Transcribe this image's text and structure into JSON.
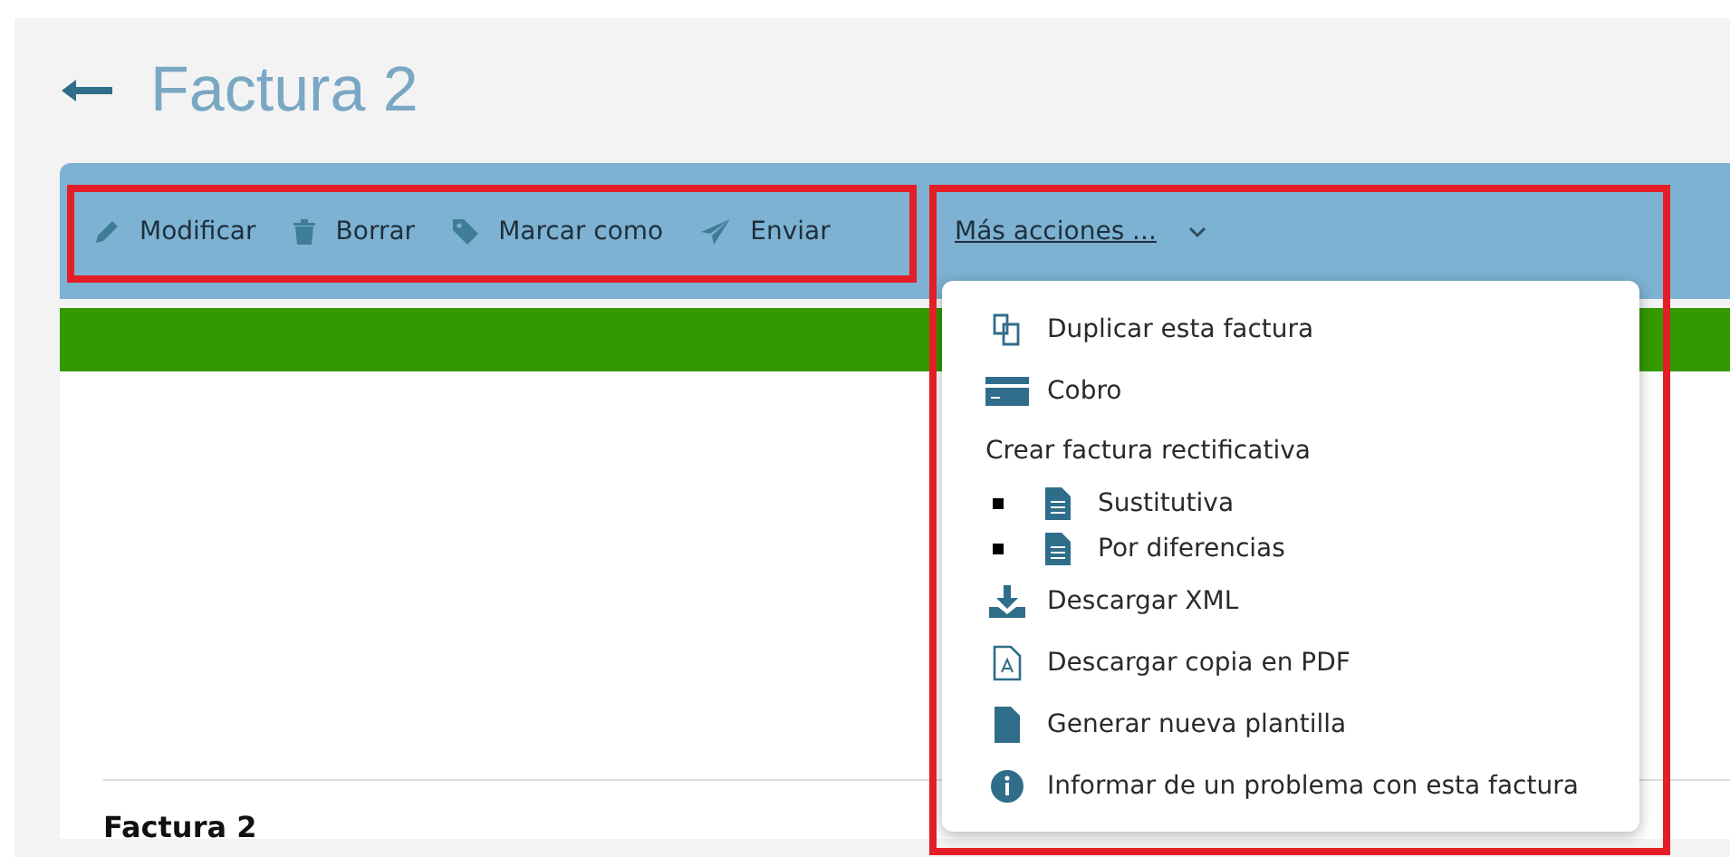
{
  "header": {
    "title": "Factura 2"
  },
  "toolbar": {
    "highlighted": true,
    "actions": [
      {
        "label": "Modificar",
        "kind": "pencil"
      },
      {
        "label": "Borrar",
        "kind": "trash"
      },
      {
        "label": "Marcar como",
        "kind": "tag"
      },
      {
        "label": "Enviar",
        "kind": "send"
      }
    ],
    "more_actions": {
      "label": "Más acciones ...",
      "expanded": true,
      "highlighted": true
    }
  },
  "menu": [
    {
      "kind": "duplicate",
      "label": "Duplicar esta factura"
    },
    {
      "kind": "card",
      "label": "Cobro"
    },
    {
      "kind": "heading",
      "label": "Crear factura rectificativa"
    },
    {
      "kind": "document",
      "label": "Sustitutiva"
    },
    {
      "kind": "document",
      "label": "Por diferencias"
    },
    {
      "kind": "download",
      "label": "Descargar XML"
    },
    {
      "kind": "pdf",
      "label": "Descargar copia en PDF"
    },
    {
      "kind": "file",
      "label": "Generar nueva plantilla"
    },
    {
      "kind": "info",
      "label": "Informar de un problema con esta factura"
    }
  ],
  "document": {
    "heading": "Factura 2"
  }
}
